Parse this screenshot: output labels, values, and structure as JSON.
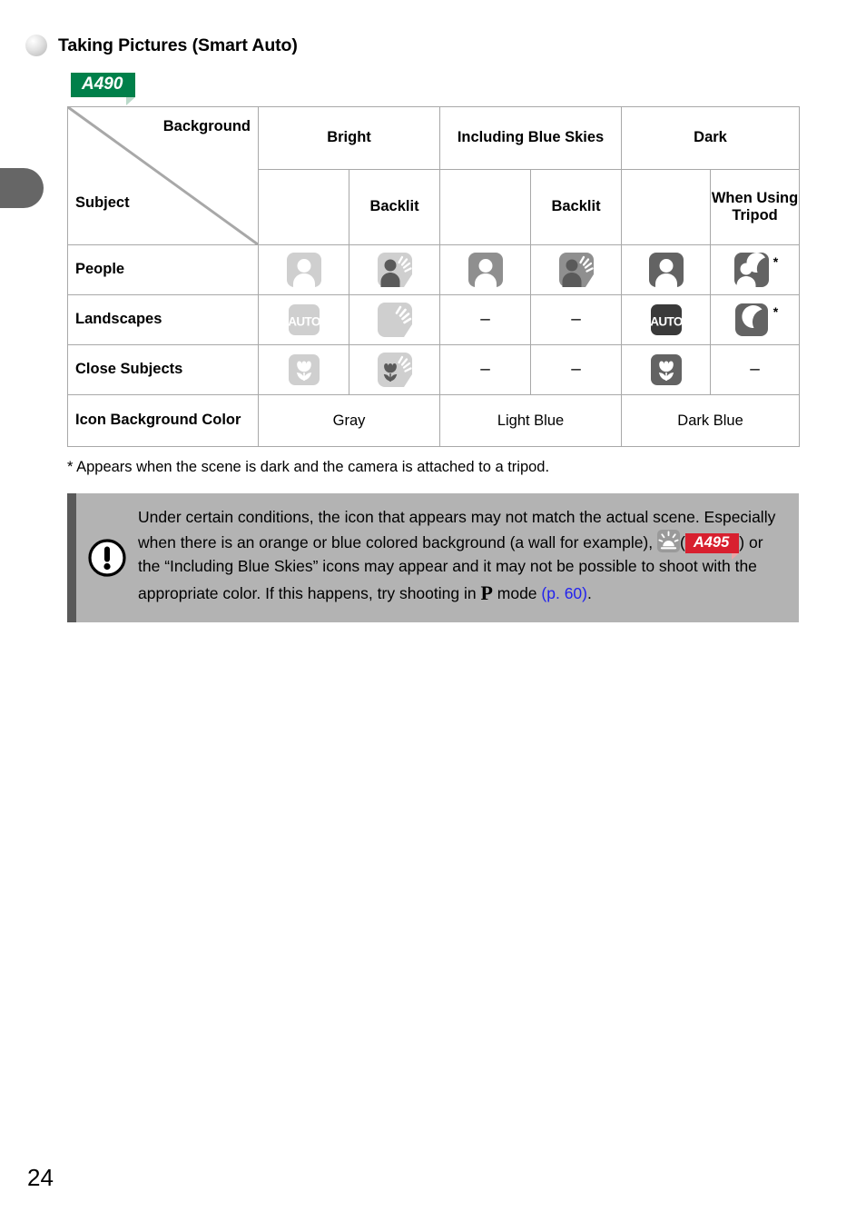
{
  "page": {
    "number": "24",
    "tab_icon": "page-tab-marker"
  },
  "header": {
    "bullet_icon": "bullet-sphere-icon",
    "title": "Taking Pictures (Smart Auto)"
  },
  "model_badge": {
    "label": "A490",
    "color": "#00804a"
  },
  "table": {
    "corner": {
      "background_label": "Background",
      "subject_label": "Subject",
      "diagonal_icon": "diagonal-divider-icon"
    },
    "columns": [
      {
        "key": "bright",
        "label": "Bright",
        "sub": ""
      },
      {
        "key": "bright_backlit",
        "label": "",
        "sub": "Backlit"
      },
      {
        "key": "blue_skies",
        "label": "Including Blue Skies",
        "sub": ""
      },
      {
        "key": "blue_skies_backlit",
        "label": "",
        "sub": "Backlit"
      },
      {
        "key": "dark",
        "label": "Dark",
        "sub": ""
      },
      {
        "key": "dark_tripod",
        "label": "",
        "sub": "When Using Tripod"
      }
    ],
    "group_headers": {
      "bright": "Bright",
      "blue_skies": "Including Blue Skies",
      "dark": "Dark"
    },
    "sub_headers": {
      "bright_backlit": "Backlit",
      "blue_skies_backlit": "Backlit",
      "dark_tripod": "When Using Tripod"
    },
    "rows": [
      {
        "label": "People",
        "cells": [
          {
            "type": "icon",
            "icon": "person-light-icon",
            "star": false
          },
          {
            "type": "icon",
            "icon": "person-backlit-light-icon",
            "star": false
          },
          {
            "type": "icon",
            "icon": "person-medium-icon",
            "star": false
          },
          {
            "type": "icon",
            "icon": "person-backlit-medium-icon",
            "star": false
          },
          {
            "type": "icon",
            "icon": "person-dark-icon",
            "star": false
          },
          {
            "type": "icon",
            "icon": "person-night-icon",
            "star": true
          }
        ]
      },
      {
        "label": "Landscapes",
        "cells": [
          {
            "type": "icon",
            "icon": "auto-light-icon",
            "star": false
          },
          {
            "type": "icon",
            "icon": "backlit-light-icon",
            "star": false
          },
          {
            "type": "dash",
            "text": "–"
          },
          {
            "type": "dash",
            "text": "–"
          },
          {
            "type": "icon",
            "icon": "auto-dark-icon",
            "star": false
          },
          {
            "type": "icon",
            "icon": "moon-night-icon",
            "star": true
          }
        ]
      },
      {
        "label": "Close Subjects",
        "cells": [
          {
            "type": "icon",
            "icon": "macro-light-icon",
            "star": false
          },
          {
            "type": "icon",
            "icon": "macro-backlit-light-icon",
            "star": false
          },
          {
            "type": "dash",
            "text": "–"
          },
          {
            "type": "dash",
            "text": "–"
          },
          {
            "type": "icon",
            "icon": "macro-dark-icon",
            "star": false
          },
          {
            "type": "dash",
            "text": "–"
          }
        ]
      }
    ],
    "color_row": {
      "label": "Icon Background Color",
      "values": [
        "Gray",
        "Light Blue",
        "Dark Blue"
      ]
    }
  },
  "footnote": "* Appears when the scene is dark and the camera is attached to a tripod.",
  "note": {
    "icon": "caution-exclamation-icon",
    "text_part1": "Under certain conditions, the icon that appears may not match the actual scene. Especially when there is an orange or blue colored background (a wall for example), ",
    "sun_icon": "sunset-icon",
    "paren_open": "(",
    "badge_label": "A495",
    "paren_close": ")",
    "text_part2": " or the “Including Blue Skies” icons may appear and it may not be possible to shoot with the appropriate color. If this happens, try shooting in ",
    "p_symbol": "P",
    "text_part3": " mode ",
    "link": "(p. 60)",
    "text_part4": ".",
    "link_color": "#2222ee"
  }
}
